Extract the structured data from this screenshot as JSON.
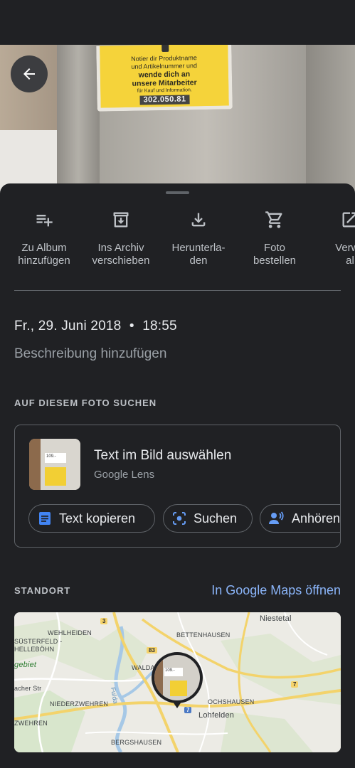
{
  "photo": {
    "sticker_lines": [
      "Notier dir Produktname",
      "und Artikelnummer und"
    ],
    "sticker_bold": [
      "wende dich an",
      "unsere Mitarbeiter"
    ],
    "sticker_small": "für Kauf und Information.",
    "sticker_code": "302.050.81"
  },
  "actions": [
    {
      "label": "Zu Album\nhinzufügen",
      "icon": "playlist-add-icon"
    },
    {
      "label": "Ins Archiv\nverschieben",
      "icon": "archive-icon"
    },
    {
      "label": "Herunterla-\nden",
      "icon": "download-icon"
    },
    {
      "label": "Foto\nbestellen",
      "icon": "shopping-cart-icon"
    },
    {
      "label": "Verwe\nal",
      "icon": "open-in-new-icon"
    }
  ],
  "details": {
    "date": "Fr., 29. Juni 2018",
    "separator": "•",
    "time": "18:55",
    "description_placeholder": "Beschreibung hinzufügen"
  },
  "lens": {
    "section_title": "AUF DIESEM FOTO SUCHEN",
    "title": "Text im Bild auswählen",
    "subtitle": "Google Lens",
    "thumb_price": "109.-",
    "chips": [
      {
        "label": "Text kopieren",
        "icon": "copy-text-icon"
      },
      {
        "label": "Suchen",
        "icon": "lens-search-icon"
      },
      {
        "label": "Anhören",
        "icon": "listen-icon"
      }
    ]
  },
  "location": {
    "section_title": "STANDORT",
    "maps_link": "In Google Maps öffnen",
    "map_labels": {
      "niestetal": "Niestetal",
      "wehlheiden": "WEHLHEIDEN",
      "bettenhausen": "BETTENHAUSEN",
      "susterfeld": "SÜSTERFELD -",
      "hellebohn": "HELLEBÖHN",
      "gebiet": "gebiet",
      "acher": "acher Str",
      "waldau": "WALDAU",
      "niederzwehren": "NIEDERZWEHREN",
      "fulda": "Fulda",
      "ochshausen": "OCHSHAUSEN",
      "zwehren": "ZWEHREN",
      "lohfelden": "Lohfelden",
      "bergshausen": "BERGSHAUSEN"
    },
    "route_numbers": {
      "r3": "3",
      "r83": "83",
      "r7a": "7",
      "r7b": "7"
    },
    "pin_price": "109.-"
  },
  "colors": {
    "background": "#202124",
    "link": "#8ab4f8",
    "chip_blue": "#4285f4",
    "chip_icon_blue": "#669df6"
  }
}
